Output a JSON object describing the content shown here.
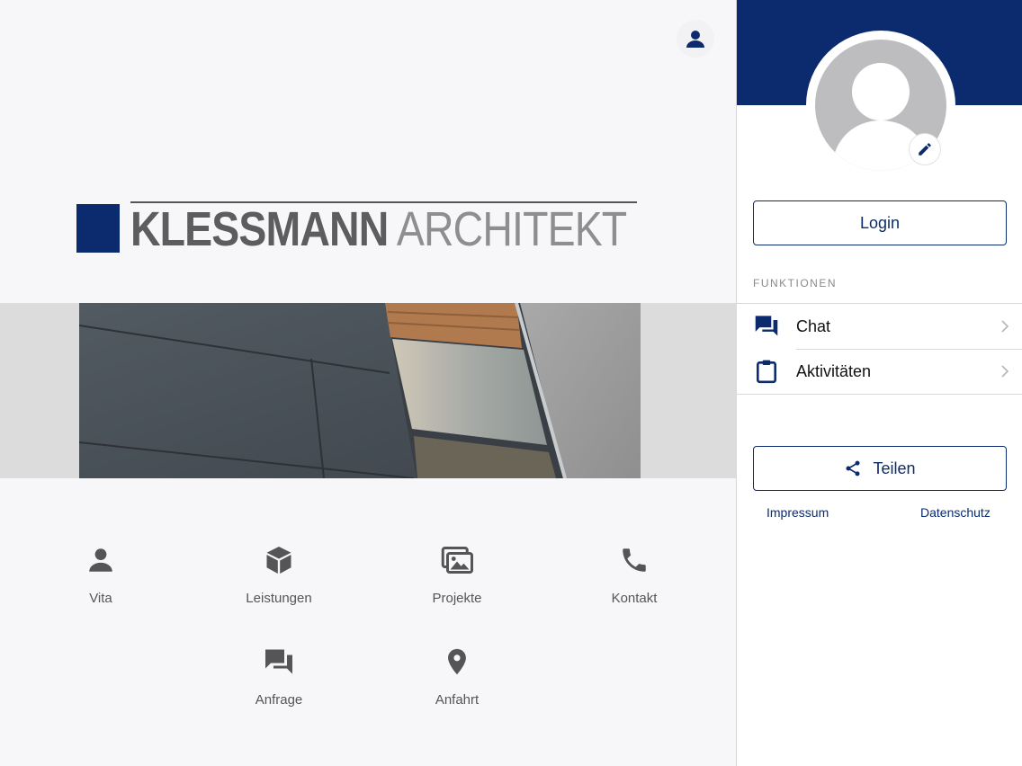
{
  "header": {
    "profile_icon": "person-icon"
  },
  "logo": {
    "brand_bold": "KLESSMANN",
    "brand_light": "ARCHITEKT",
    "brand_color": "#0b2b6e"
  },
  "banner": {
    "description_icon": "building-facade-image"
  },
  "nav": [
    {
      "label": "Vita",
      "icon": "person-icon"
    },
    {
      "label": "Leistungen",
      "icon": "cube-icon"
    },
    {
      "label": "Projekte",
      "icon": "photos-icon"
    },
    {
      "label": "Kontakt",
      "icon": "phone-icon"
    },
    {
      "label": "Anfrage",
      "icon": "chat-bubbles-icon"
    },
    {
      "label": "Anfahrt",
      "icon": "location-pin-icon"
    }
  ],
  "drawer": {
    "accent": "#0b2b6e",
    "login_label": "Login",
    "section_label": "FUNKTIONEN",
    "items": [
      {
        "label": "Chat",
        "icon": "chat-icon"
      },
      {
        "label": "Aktivitäten",
        "icon": "clipboard-icon"
      }
    ],
    "share_label": "Teilen",
    "impressum_label": "Impressum",
    "datenschutz_label": "Datenschutz"
  }
}
